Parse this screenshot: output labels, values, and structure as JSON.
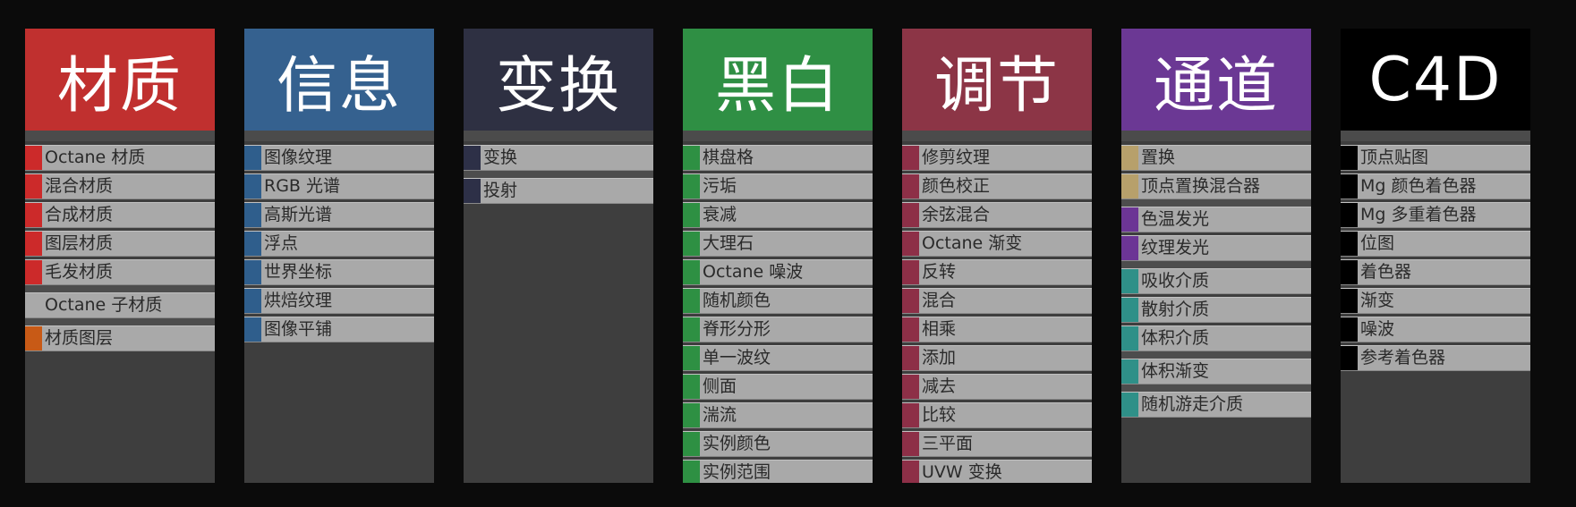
{
  "columns": [
    {
      "id": "material",
      "title": "材质",
      "header_color": "#c0302f",
      "groups": [
        [
          {
            "label": "Octane 材质",
            "color": "#cc2a2a"
          },
          {
            "label": "混合材质",
            "color": "#cc2a2a"
          },
          {
            "label": "合成材质",
            "color": "#cc2a2a"
          },
          {
            "label": "图层材质",
            "color": "#cc2a2a"
          },
          {
            "label": "毛发材质",
            "color": "#cc2a2a"
          }
        ],
        [
          {
            "label": "Octane 子材质",
            "color": "#a9a9a9"
          }
        ],
        [
          {
            "label": "材质图层",
            "color": "#c85a16"
          }
        ]
      ]
    },
    {
      "id": "info",
      "title": "信息",
      "header_color": "#35618f",
      "groups": [
        [
          {
            "label": "图像纹理",
            "color": "#2f5e8c"
          },
          {
            "label": "RGB 光谱",
            "color": "#2f5e8c"
          },
          {
            "label": "高斯光谱",
            "color": "#2f5e8c"
          },
          {
            "label": "浮点",
            "color": "#2f5e8c"
          },
          {
            "label": "世界坐标",
            "color": "#2f5e8c"
          },
          {
            "label": "烘焙纹理",
            "color": "#2f5e8c"
          },
          {
            "label": "图像平铺",
            "color": "#2f5e8c"
          }
        ]
      ]
    },
    {
      "id": "transform",
      "title": "变换",
      "header_color": "#2e3042",
      "groups": [
        [
          {
            "label": "变换",
            "color": "#2d3047"
          }
        ],
        [
          {
            "label": "投射",
            "color": "#2d3047"
          }
        ]
      ]
    },
    {
      "id": "bw",
      "title": "黑白",
      "header_color": "#2f8f44",
      "groups": [
        [
          {
            "label": "棋盘格",
            "color": "#2e9043"
          },
          {
            "label": "污垢",
            "color": "#2e9043"
          },
          {
            "label": "衰减",
            "color": "#2e9043"
          },
          {
            "label": "大理石",
            "color": "#2e9043"
          },
          {
            "label": "Octane 噪波",
            "color": "#2e9043"
          },
          {
            "label": "随机颜色",
            "color": "#2e9043"
          },
          {
            "label": "脊形分形",
            "color": "#2e9043"
          },
          {
            "label": "单一波纹",
            "color": "#2e9043"
          },
          {
            "label": "侧面",
            "color": "#2e9043"
          },
          {
            "label": "湍流",
            "color": "#2e9043"
          },
          {
            "label": "实例颜色",
            "color": "#2e9043"
          },
          {
            "label": "实例范围",
            "color": "#2e9043"
          }
        ]
      ]
    },
    {
      "id": "adjust",
      "title": "调节",
      "header_color": "#8c3546",
      "groups": [
        [
          {
            "label": "修剪纹理",
            "color": "#8d2f47"
          },
          {
            "label": "颜色校正",
            "color": "#8d2f47"
          },
          {
            "label": "余弦混合",
            "color": "#8d2f47"
          },
          {
            "label": "Octane 渐变",
            "color": "#8d2f47"
          },
          {
            "label": "反转",
            "color": "#8d2f47"
          },
          {
            "label": "混合",
            "color": "#8d2f47"
          },
          {
            "label": "相乘",
            "color": "#8d2f47"
          },
          {
            "label": "添加",
            "color": "#8d2f47"
          },
          {
            "label": "减去",
            "color": "#8d2f47"
          },
          {
            "label": "比较",
            "color": "#8d2f47"
          },
          {
            "label": "三平面",
            "color": "#8d2f47"
          },
          {
            "label": "UVW 变换",
            "color": "#8d2f47"
          }
        ]
      ]
    },
    {
      "id": "channel",
      "title": "通道",
      "header_color": "#6b3894",
      "groups": [
        [
          {
            "label": "置换",
            "color": "#b7a06b"
          },
          {
            "label": "顶点置换混合器",
            "color": "#b7a06b"
          }
        ],
        [
          {
            "label": "色温发光",
            "color": "#6c3595"
          },
          {
            "label": "纹理发光",
            "color": "#6c3595"
          }
        ],
        [
          {
            "label": "吸收介质",
            "color": "#2f9088"
          },
          {
            "label": "散射介质",
            "color": "#2f9088"
          },
          {
            "label": "体积介质",
            "color": "#2f9088"
          }
        ],
        [
          {
            "label": "体积渐变",
            "color": "#2f9088"
          }
        ],
        [
          {
            "label": "随机游走介质",
            "color": "#2f9088"
          }
        ]
      ]
    },
    {
      "id": "c4d",
      "title": "C4D",
      "header_color": "#000000",
      "groups": [
        [
          {
            "label": "顶点贴图",
            "color": "#000000"
          },
          {
            "label": "Mg 颜色着色器",
            "color": "#000000"
          },
          {
            "label": "Mg 多重着色器",
            "color": "#000000"
          },
          {
            "label": "位图",
            "color": "#000000"
          },
          {
            "label": "着色器",
            "color": "#000000"
          },
          {
            "label": "渐变",
            "color": "#000000"
          },
          {
            "label": "噪波",
            "color": "#000000"
          },
          {
            "label": "参考着色器",
            "color": "#000000"
          }
        ]
      ]
    }
  ]
}
